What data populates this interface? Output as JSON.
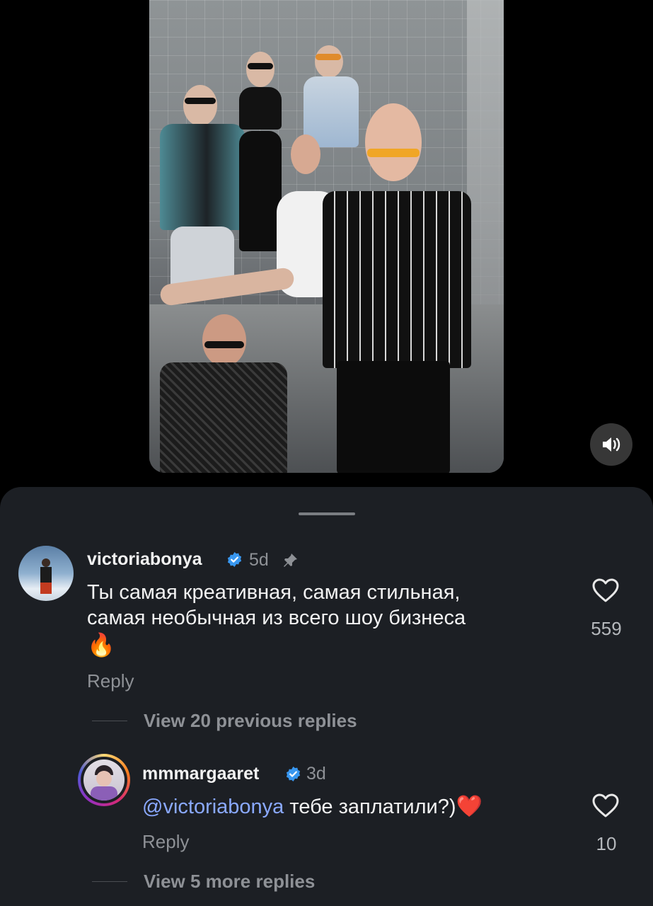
{
  "comments": [
    {
      "username": "victoriabonya",
      "time": "5d",
      "text_lines": [
        "Ты самая креативная, самая стильная,",
        "самая необычная из всего шоу бизнеса"
      ],
      "emoji": "🔥",
      "reply_label": "Reply",
      "likes": "559",
      "pinned": true,
      "view_replies": "View 20 previous replies"
    },
    {
      "username": "mmmargaaret",
      "time": "3d",
      "mention": "@victoriabonya",
      "text": " тебе заплатили?)",
      "emoji": "❤️",
      "reply_label": "Reply",
      "likes": "10",
      "view_replies": "View 5 more replies"
    }
  ],
  "colors": {
    "sheet_bg": "#1c1f24",
    "mention": "#8aa9ff",
    "verified": "#3897f0"
  }
}
